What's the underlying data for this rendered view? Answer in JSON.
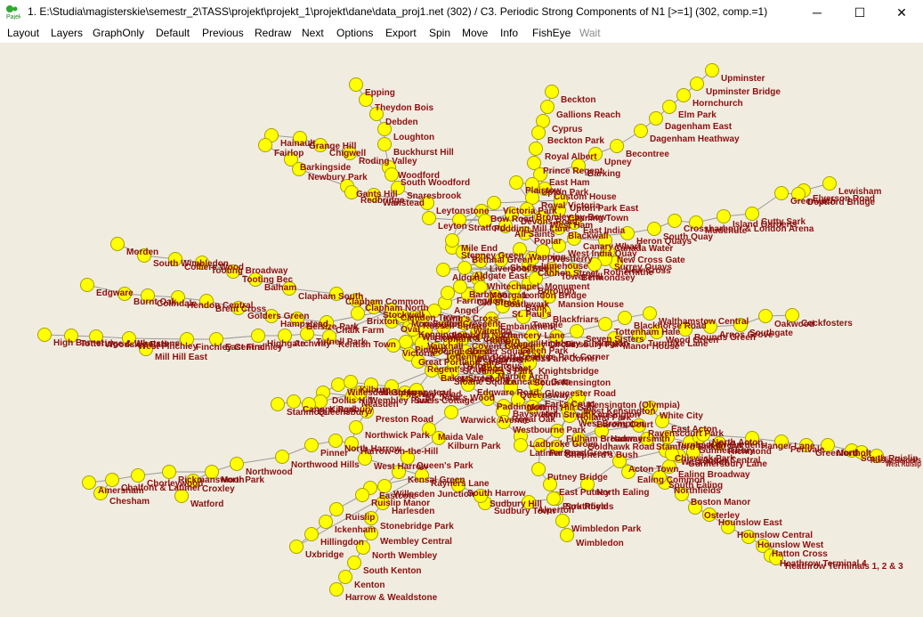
{
  "window": {
    "title": "1. E:\\Studia\\magisterskie\\semestr_2\\TASS\\projekt\\projekt_1\\projekt\\dane\\data_proj1.net (302) / C3. Periodic Strong Components of N1 [>=1] (302, comp.=1)",
    "minimize": "─",
    "maximize": "☐",
    "close": "✕"
  },
  "menu": [
    {
      "label": "Layout",
      "enabled": true
    },
    {
      "label": "Layers",
      "enabled": true
    },
    {
      "label": "GraphOnly",
      "enabled": true
    },
    {
      "label": "Default",
      "enabled": true
    },
    {
      "label": "Previous",
      "enabled": true
    },
    {
      "label": "Redraw",
      "enabled": true
    },
    {
      "label": "Next",
      "enabled": true
    },
    {
      "label": "Options",
      "enabled": true
    },
    {
      "label": "Export",
      "enabled": true
    },
    {
      "label": "Spin",
      "enabled": true
    },
    {
      "label": "Move",
      "enabled": true
    },
    {
      "label": "Info",
      "enabled": true
    },
    {
      "label": "FishEye",
      "enabled": true
    },
    {
      "label": "Wait",
      "enabled": false
    }
  ],
  "colors": {
    "canvas": "#f1ece0",
    "node_fill": "#ffff00",
    "node_stroke": "#a6a000",
    "label": "#8b1010",
    "edge": "#9a9a9a"
  },
  "stations": [
    "Epping",
    "Theydon Bois",
    "Debden",
    "Loughton",
    "Buckhurst Hill",
    "Woodford",
    "South Woodford",
    "Snaresbrook",
    "Wanstead",
    "Hainault",
    "Grange Hill",
    "Chigwell",
    "Roding Valley",
    "Fairlop",
    "Barkingside",
    "Newbury Park",
    "Gants Hill",
    "Beckton",
    "Gallions Reach",
    "Cyprus",
    "Beckton Park",
    "Royal Albert",
    "Prince Regent",
    "East Ham",
    "Upton Park",
    "Plaistow",
    "Royal Victoria",
    "Custom House",
    "Bow Road",
    "Stratford",
    "Upminster",
    "Upminster Bridge",
    "Hornchurch",
    "Elm Park",
    "Dagenham East",
    "Dagenham Heathway",
    "Becontree",
    "Upney",
    "Barking",
    "Lewisham",
    "Elverson Road",
    "Deptford Bridge",
    "Greenwich",
    "Cutty Sark",
    "Island Gardens",
    "Mudchute",
    "Crossharbour & London Arena",
    "South Quay",
    "Heron Quays",
    "Canada Water",
    "New Cross Gate",
    "New Cross",
    "Surrey Quays",
    "Rotherhithe",
    "Bermondsey",
    "Borough",
    "London Bridge",
    "Morden",
    "South Wimbledon",
    "Colliers Wood",
    "Tooting Broadway",
    "Tooting Bec",
    "Balham",
    "Clapham South",
    "Clapham Common",
    "Clapham North",
    "Stockwell",
    "Brixton",
    "Edgware",
    "Burnt Oak",
    "Colindale",
    "Hendon Central",
    "Brent Cross",
    "Golders Green",
    "Hampstead",
    "Belsize Park",
    "Chalk Farm",
    "High Barnet",
    "Totteridge & Whetstone",
    "Woodside Park",
    "West Finchley",
    "Finchley Central",
    "East Finchley",
    "Highgate",
    "Archway",
    "Tufnell Park",
    "Kentish Town",
    "Mill Hill East",
    "Walthamstow Central",
    "Blackhorse Road",
    "Tottenham Hale",
    "Seven Sisters",
    "Finsbury Park",
    "Highbury & Islington",
    "Oakwood",
    "Cockfosters",
    "Southgate",
    "Arnos Grove",
    "Bounds Green",
    "Wood Green",
    "Turnpike Lane",
    "Manor House",
    "Mansion House",
    "Blackfriars",
    "Temple",
    "Embankment",
    "Waterloo",
    "Lambeth North",
    "Elephant & Castle",
    "Kennington",
    "Oval",
    "Vauxhall",
    "Pimlico",
    "Victoria",
    "Southwark",
    "Park Corner",
    "Knightsbridge",
    "South Kensington",
    "Gloucester Road",
    "Earl's Court",
    "West Kensington",
    "Kensington (Olympia)",
    "West Brompton",
    "Fulham Broadway",
    "Parsons Green",
    "Putney Bridge",
    "East Putney",
    "Southfields",
    "Wimbledon Park",
    "Wimbledon",
    "Baker Street",
    "Marylebone",
    "Edgware Road",
    "Paddington",
    "Bayswater",
    "Notting Hill Gate",
    "Queensway",
    "Lancaster Gate",
    "Marble Arch",
    "Bond Street",
    "Oxford Circus",
    "Warwick Avenue",
    "Maida Vale",
    "Kilburn Park",
    "Queen's Park",
    "Kensal Green",
    "Willesden Junction",
    "Harlesden",
    "Stonebridge Park",
    "Wembley Central",
    "North Wembley",
    "South Kenton",
    "Kenton",
    "Harrow & Wealdstone",
    "Royal Oak",
    "Westbourne Park",
    "Ladbroke Grove",
    "Latimer Road",
    "Shepherd's Bush",
    "Goldhawk Road",
    "Hammersmith",
    "Barons Court",
    "Ravenscourt Park",
    "Stamford Brook",
    "Turnham Green",
    "Chiswick Park",
    "Acton Town",
    "Gunnersbury",
    "Kew Gardens",
    "Richmond",
    "Ealing Common",
    "Ealing Broadway",
    "North Ealing",
    "Park Royal",
    "Alperton",
    "Sudbury Town",
    "Sudbury Hill",
    "South Harrow",
    "Rayners Lane",
    "Eastcote",
    "Ruislip Manor",
    "Ruislip",
    "Ickenham",
    "Hillingdon",
    "Uxbridge",
    "West Harrow",
    "Harrow-on-the-Hill",
    "North Harrow",
    "Pinner",
    "Northwood Hills",
    "Northwood",
    "Moor Park",
    "Rickmansworth",
    "Chorleywood",
    "Chalfont & Latimer",
    "Amersham",
    "Chesham",
    "Croxley",
    "Watford",
    "Northfields",
    "Boston Manor",
    "Osterley",
    "Hounslow East",
    "Hounslow Central",
    "Hounslow West",
    "Hatton Cross",
    "Heathrow Terminal 4",
    "Heathrow Terminals 1, 2 & 3",
    "South Ealing",
    "Acton Central",
    "Gunnersbury Lane",
    "West Acton",
    "Willesden Green",
    "Dollis Hill",
    "Neasden",
    "Kingsbury",
    "Queensbury",
    "Canons Park",
    "Stanmore",
    "Wembley Park",
    "Preston Road",
    "Northwick Park",
    "Kilburn",
    "West Hampstead",
    "Finchley Road",
    "Swiss Cottage",
    "St. John's Wood",
    "Stepney Green",
    "Mile End",
    "Bethnal Green",
    "Liverpool Street",
    "Aldgate",
    "Aldgate East",
    "Whitechapel",
    "Shadwell",
    "Wapping",
    "Moorgate",
    "Old Street",
    "Angel",
    "King's Cross",
    "Euston",
    "Warren Street",
    "Goodge Street",
    "Tottenham Court Road",
    "Leicester Square",
    "Covent Garden",
    "Holborn",
    "Russell Square",
    "Chancery Lane",
    "St. Paul's",
    "Bank",
    "Monument",
    "Tower Hill",
    "Cannon Street",
    "Barbican",
    "Farringdon",
    "Mornington Crescent",
    "Camden Town",
    "Great Portland Street",
    "Regent's Park",
    "Hyde Park Corner",
    "Green Park",
    "Piccadilly Circus",
    "Charing Cross",
    "Westminster",
    "St. James's Park",
    "Sloane Square",
    "High Street Kensington",
    "Holland Park",
    "White City",
    "East Acton",
    "North Acton",
    "Hanger Lane",
    "Perivale",
    "Greenford",
    "Northolt",
    "South Ruislip",
    "Ruislip Gardens",
    "West Ruislip",
    "Leyton",
    "Leytonstone",
    "Redbridge",
    "Pudding Mill Lane",
    "Devons Road",
    "All Saints",
    "Poplar",
    "Westferry",
    "Limehouse",
    "West India Quay",
    "Canary Wharf",
    "Blackwall",
    "East India",
    "Canning Town",
    "West Ham",
    "Bromley-by-Bow",
    "Upton Park East",
    "Victoria Park"
  ]
}
